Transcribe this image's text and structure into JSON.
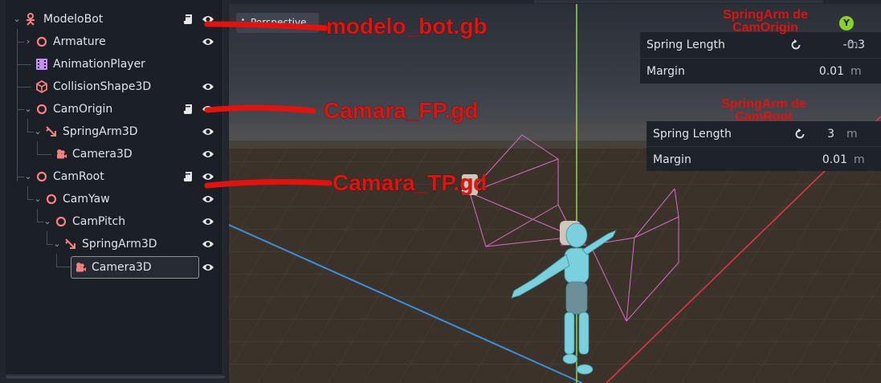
{
  "scene_tree": {
    "nodes": [
      {
        "label": "ModeloBot",
        "icon": "skeleton-icon",
        "expanded": true,
        "has_script": true,
        "visible": true
      },
      {
        "label": "Armature",
        "icon": "node3d-icon",
        "expanded": false,
        "has_script": false,
        "visible": true
      },
      {
        "label": "AnimationPlayer",
        "icon": "animation-player-icon",
        "has_script": false,
        "visible": false
      },
      {
        "label": "CollisionShape3D",
        "icon": "collision-shape-icon",
        "has_script": false,
        "visible": true
      },
      {
        "label": "CamOrigin",
        "icon": "node3d-icon",
        "expanded": true,
        "has_script": true,
        "visible": true
      },
      {
        "label": "SpringArm3D",
        "icon": "spring-arm-icon",
        "expanded": true,
        "has_script": false,
        "visible": true
      },
      {
        "label": "Camera3D",
        "icon": "camera-icon",
        "has_script": false,
        "visible": true
      },
      {
        "label": "CamRoot",
        "icon": "node3d-icon",
        "expanded": true,
        "has_script": true,
        "visible": true
      },
      {
        "label": "CamYaw",
        "icon": "node3d-icon",
        "expanded": true,
        "has_script": false,
        "visible": true
      },
      {
        "label": "CamPitch",
        "icon": "node3d-icon",
        "expanded": true,
        "has_script": false,
        "visible": true
      },
      {
        "label": "SpringArm3D",
        "icon": "spring-arm-icon",
        "expanded": true,
        "has_script": false,
        "visible": true
      },
      {
        "label": "Camera3D",
        "icon": "camera-icon",
        "has_script": false,
        "visible": true,
        "selected": true
      }
    ]
  },
  "viewport": {
    "perspective_label": "Perspective",
    "gizmo_y_label": "Y"
  },
  "inspector_camorigin": {
    "spring_length_label": "Spring Length",
    "spring_length_value": "-0.3",
    "spring_length_unit": "m",
    "margin_label": "Margin",
    "margin_value": "0.01",
    "margin_unit": "m"
  },
  "inspector_camroot": {
    "spring_length_label": "Spring Length",
    "spring_length_value": "3",
    "spring_length_unit": "m",
    "margin_label": "Margin",
    "margin_value": "0.01",
    "margin_unit": "m"
  },
  "annotations": {
    "modelo_bot": "modelo_bot.gb",
    "camara_fp": "Camara_FP.gd",
    "camara_tp": "Camara_TP.gd",
    "springarm_camorigin_line1": "SpringArm de",
    "springarm_camorigin_line2": "CamOrigin",
    "springarm_camroot_line1": "SpringArm de",
    "springarm_camroot_line2": "CamRoot"
  },
  "colors": {
    "annotation_red": "#e0130f",
    "node3d_icon": "#fc7f7f",
    "animation_icon": "#c38ef1",
    "eye_icon": "#e6e9ee",
    "y_axis": "#8bd12d",
    "x_axis": "#e0344a",
    "z_axis": "#3a8fe0"
  }
}
